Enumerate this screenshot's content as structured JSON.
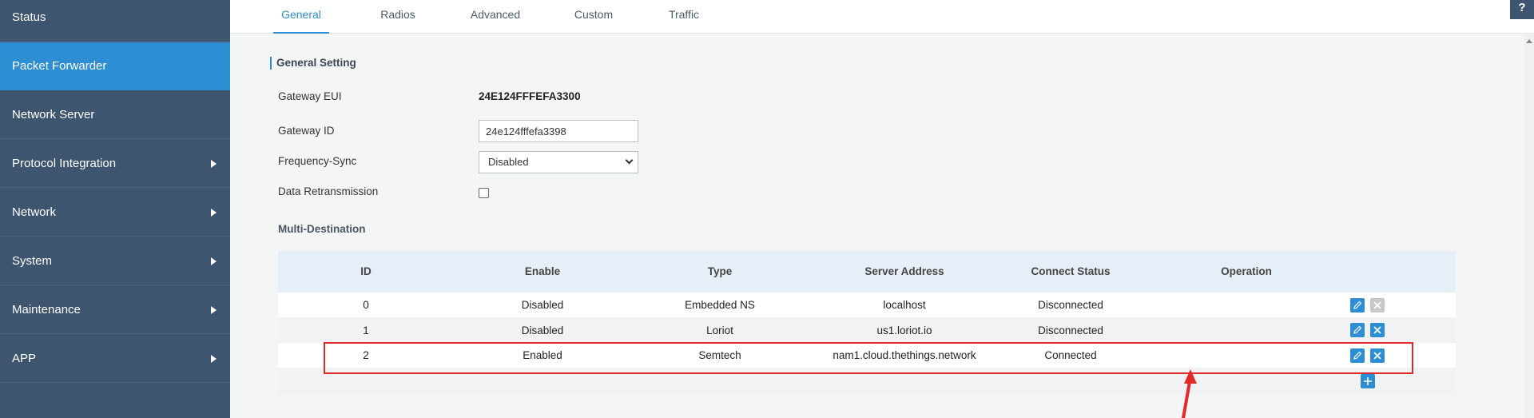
{
  "sidebar": {
    "items": [
      {
        "label": "Status"
      },
      {
        "label": "Packet Forwarder"
      },
      {
        "label": "Network Server"
      },
      {
        "label": "Protocol Integration"
      },
      {
        "label": "Network"
      },
      {
        "label": "System"
      },
      {
        "label": "Maintenance"
      },
      {
        "label": "APP"
      }
    ]
  },
  "tabs": [
    {
      "label": "General"
    },
    {
      "label": "Radios"
    },
    {
      "label": "Advanced"
    },
    {
      "label": "Custom"
    },
    {
      "label": "Traffic"
    }
  ],
  "help_label": "?",
  "section_title": "General Setting",
  "gateway_eui": {
    "label": "Gateway EUI",
    "value": "24E124FFFEFA3300"
  },
  "gateway_id": {
    "label": "Gateway ID",
    "value": "24e124fffefa3398"
  },
  "frequency_sync": {
    "label": "Frequency-Sync",
    "value": "Disabled"
  },
  "data_retransmission": {
    "label": "Data Retransmission"
  },
  "multi_destination": {
    "title": "Multi-Destination",
    "columns": [
      "ID",
      "Enable",
      "Type",
      "Server Address",
      "Connect Status",
      "Operation"
    ],
    "rows": [
      [
        "0",
        "Disabled",
        "Embedded NS",
        "localhost",
        "Disconnected"
      ],
      [
        "1",
        "Disabled",
        "Loriot",
        "us1.loriot.io",
        "Disconnected"
      ],
      [
        "2",
        "Enabled",
        "Semtech",
        "nam1.cloud.thethings.network",
        "Connected"
      ]
    ]
  },
  "colors": {
    "sidebar_bg": "#3e5570",
    "accent": "#2d8ed3",
    "highlight": "#e02a2a"
  }
}
